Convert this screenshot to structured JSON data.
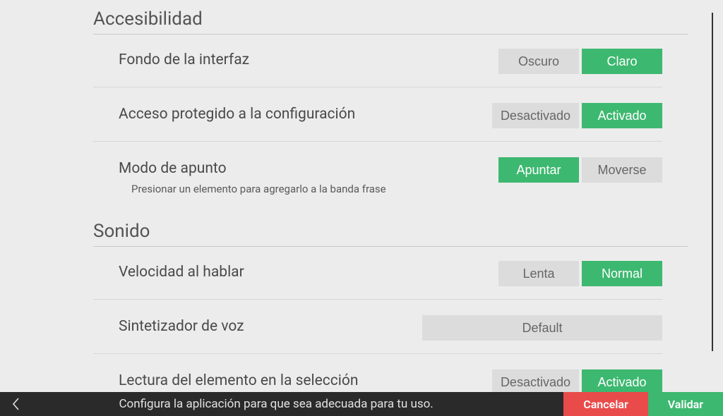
{
  "sections": {
    "accessibility": {
      "title": "Accesibilidad",
      "background": {
        "label": "Fondo de la interfaz",
        "option_inactive": "Oscuro",
        "option_active": "Claro"
      },
      "protected_access": {
        "label": "Acceso protegido a la configuración",
        "option_inactive": "Desactivado",
        "option_active": "Activado"
      },
      "pointing_mode": {
        "label": "Modo de apunto",
        "sublabel": "Presionar un elemento para agregarlo a la banda frase",
        "option_active": "Apuntar",
        "option_inactive": "Moverse"
      }
    },
    "sound": {
      "title": "Sonido",
      "speech_speed": {
        "label": "Velocidad al hablar",
        "option_inactive": "Lenta",
        "option_active": "Normal"
      },
      "voice_synth": {
        "label": "Sintetizador de voz",
        "value": "Default"
      },
      "read_on_select": {
        "label": "Lectura del elemento en la selección",
        "option_inactive": "Desactivado",
        "option_active": "Activado"
      }
    }
  },
  "footer": {
    "text": "Configura la aplicación para que sea adecuada para tu uso.",
    "cancel": "Cancelar",
    "validate": "Validar"
  }
}
